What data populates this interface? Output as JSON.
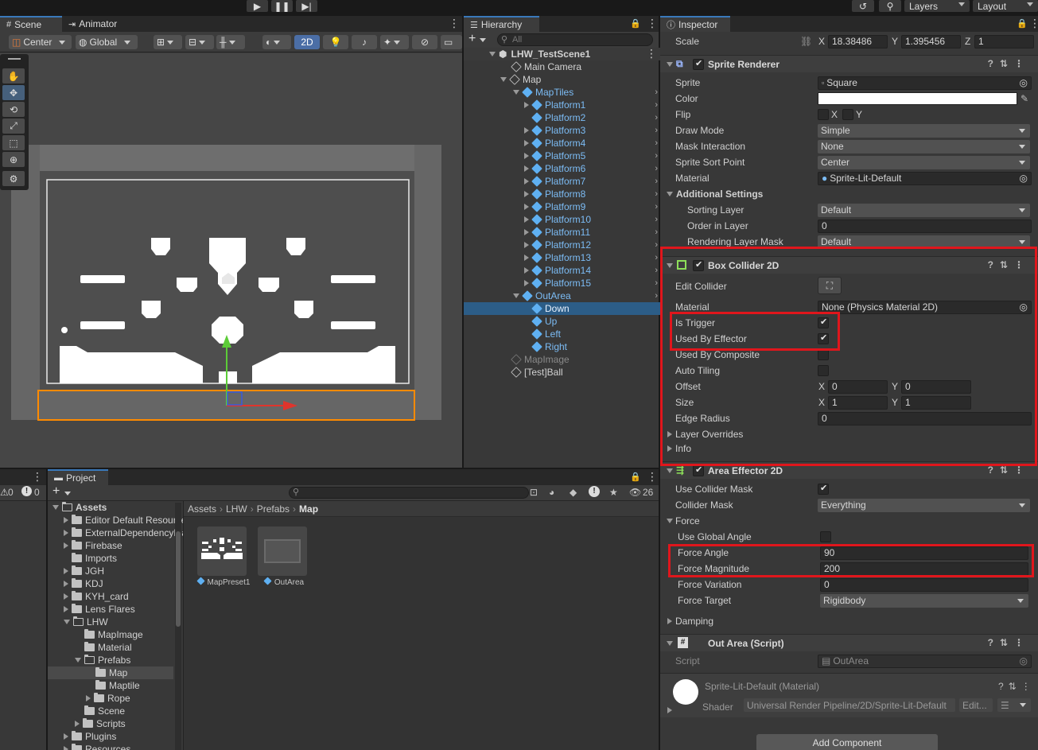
{
  "top_toolbar": {
    "layers_label": "Layers",
    "layout_label": "Layout"
  },
  "scene": {
    "tab_scene": "Scene",
    "tab_animator": "Animator",
    "pivot_label": "Center",
    "space_label": "Global",
    "mode_2d": "2D"
  },
  "hierarchy": {
    "tab_label": "Hierarchy",
    "search_placeholder": "All",
    "scene_name": "LHW_TestScene1",
    "items": [
      {
        "name": "Main Camera"
      },
      {
        "name": "Map"
      },
      {
        "name": "MapTiles"
      },
      {
        "name": "Platform1"
      },
      {
        "name": "Platform2"
      },
      {
        "name": "Platform3"
      },
      {
        "name": "Platform4"
      },
      {
        "name": "Platform5"
      },
      {
        "name": "Platform6"
      },
      {
        "name": "Platform7"
      },
      {
        "name": "Platform8"
      },
      {
        "name": "Platform9"
      },
      {
        "name": "Platform10"
      },
      {
        "name": "Platform11"
      },
      {
        "name": "Platform12"
      },
      {
        "name": "Platform13"
      },
      {
        "name": "Platform14"
      },
      {
        "name": "Platform15"
      },
      {
        "name": "OutArea"
      },
      {
        "name": "Down"
      },
      {
        "name": "Up"
      },
      {
        "name": "Left"
      },
      {
        "name": "Right"
      },
      {
        "name": "MapImage"
      },
      {
        "name": "[Test]Ball"
      }
    ]
  },
  "inspector": {
    "tab_label": "Inspector",
    "scale_label": "Scale",
    "scale_x": "18.38486",
    "scale_y": "1.395456",
    "scale_z": "1",
    "axis_x": "X",
    "axis_y": "Y",
    "axis_z": "Z",
    "sprite_renderer": {
      "title": "Sprite Renderer",
      "sprite_label": "Sprite",
      "sprite_value": "Square",
      "color_label": "Color",
      "flip_label": "Flip",
      "flip_x": "X",
      "flip_y": "Y",
      "draw_mode_label": "Draw Mode",
      "draw_mode_value": "Simple",
      "mask_label": "Mask Interaction",
      "mask_value": "None",
      "sort_point_label": "Sprite Sort Point",
      "sort_point_value": "Center",
      "material_label": "Material",
      "material_value": "Sprite-Lit-Default",
      "additional_label": "Additional Settings",
      "sorting_layer_label": "Sorting Layer",
      "sorting_layer_value": "Default",
      "order_label": "Order in Layer",
      "order_value": "0",
      "rendering_mask_label": "Rendering Layer Mask",
      "rendering_mask_value": "Default"
    },
    "box_collider": {
      "title": "Box Collider 2D",
      "edit_label": "Edit Collider",
      "material_label": "Material",
      "material_value": "None (Physics Material 2D)",
      "is_trigger_label": "Is Trigger",
      "used_by_effector_label": "Used By Effector",
      "used_by_composite_label": "Used By Composite",
      "auto_tiling_label": "Auto Tiling",
      "offset_label": "Offset",
      "offset_x": "0",
      "offset_y": "0",
      "size_label": "Size",
      "size_x": "1",
      "size_y": "1",
      "edge_radius_label": "Edge Radius",
      "edge_radius_value": "0",
      "layer_overrides_label": "Layer Overrides",
      "info_label": "Info"
    },
    "area_effector": {
      "title": "Area Effector 2D",
      "use_collider_mask_label": "Use Collider Mask",
      "collider_mask_label": "Collider Mask",
      "collider_mask_value": "Everything",
      "force_label": "Force",
      "use_global_angle_label": "Use Global Angle",
      "force_angle_label": "Force Angle",
      "force_angle_value": "90",
      "force_magnitude_label": "Force Magnitude",
      "force_magnitude_value": "200",
      "force_variation_label": "Force Variation",
      "force_variation_value": "0",
      "force_target_label": "Force Target",
      "force_target_value": "Rigidbody",
      "damping_label": "Damping"
    },
    "out_area": {
      "title": "Out Area (Script)",
      "script_label": "Script",
      "script_value": "OutArea"
    },
    "material_preview": {
      "name": "Sprite-Lit-Default (Material)",
      "shader_label": "Shader",
      "shader_value": "Universal Render Pipeline/2D/Sprite-Lit-Default",
      "edit_label": "Edit..."
    },
    "add_component": "Add Component"
  },
  "console_mini": {
    "warn_count": "0",
    "error_count": "0"
  },
  "project": {
    "tab_label": "Project",
    "hidden_count": "26",
    "breadcrumb": [
      "Assets",
      "LHW",
      "Prefabs",
      "Map"
    ],
    "tree": [
      {
        "name": "Assets"
      },
      {
        "name": "Editor Default Resources"
      },
      {
        "name": "ExternalDependencyManager"
      },
      {
        "name": "Firebase"
      },
      {
        "name": "Imports"
      },
      {
        "name": "JGH"
      },
      {
        "name": "KDJ"
      },
      {
        "name": "KYH_card"
      },
      {
        "name": "Lens Flares"
      },
      {
        "name": "LHW"
      },
      {
        "name": "MapImage"
      },
      {
        "name": "Material"
      },
      {
        "name": "Prefabs"
      },
      {
        "name": "Map"
      },
      {
        "name": "Maptile"
      },
      {
        "name": "Rope"
      },
      {
        "name": "Scene"
      },
      {
        "name": "Scripts"
      },
      {
        "name": "Plugins"
      },
      {
        "name": "Resources"
      }
    ],
    "assets": [
      {
        "name": "MapPreset1"
      },
      {
        "name": "OutArea"
      }
    ]
  },
  "colors": {
    "accent_blue": "#2c5d87",
    "prefab_blue": "#7cbcf5",
    "highlight_red": "#e0161c",
    "selection_orange": "#ff8a00"
  }
}
